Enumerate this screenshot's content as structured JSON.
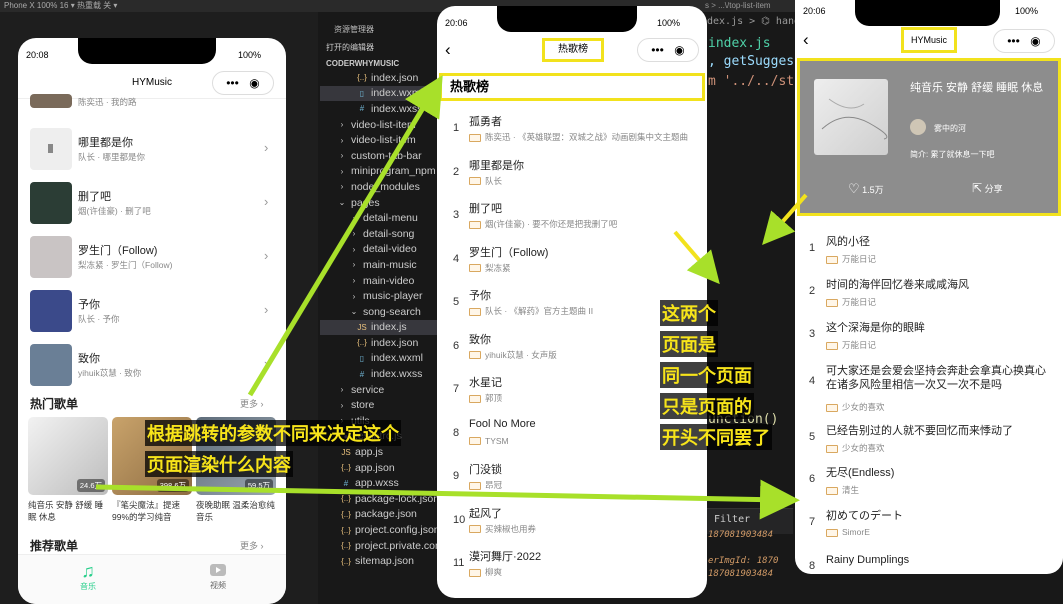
{
  "top_bar": {
    "text": "Phone X 100% 16 ▾    热重载 关 ▾",
    "breadcrumb": "s > ...\\/top-list-item"
  },
  "explorer": {
    "header": "资源管理器",
    "sections": [
      "打开的编辑器",
      "CODERWHYMUSIC"
    ],
    "items": [
      {
        "label": "index.json",
        "icon": "{..}",
        "color": "#e8c07d"
      },
      {
        "label": "index.wxml",
        "icon": "▯",
        "color": "#6fb3d2",
        "active": true
      },
      {
        "label": "index.wxss",
        "icon": "#",
        "color": "#6fb3d2"
      },
      {
        "label": "video-list-item",
        "icon": "›",
        "color": "#ccc"
      },
      {
        "label": "video-list-item",
        "icon": "›",
        "color": "#ccc"
      },
      {
        "label": "custom-tab-bar",
        "icon": "›",
        "color": "#ccc"
      },
      {
        "label": "miniprogram_npm",
        "icon": "›",
        "color": "#ccc"
      },
      {
        "label": "node_modules",
        "icon": "›",
        "color": "#ccc"
      },
      {
        "label": "pages",
        "icon": "⌄",
        "color": "#ccc"
      },
      {
        "label": "detail-menu",
        "icon": "›",
        "color": "#ccc"
      },
      {
        "label": "detail-song",
        "icon": "›",
        "color": "#ccc"
      },
      {
        "label": "detail-video",
        "icon": "›",
        "color": "#ccc"
      },
      {
        "label": "main-music",
        "icon": "›",
        "color": "#ccc"
      },
      {
        "label": "main-video",
        "icon": "›",
        "color": "#ccc"
      },
      {
        "label": "music-player",
        "icon": "›",
        "color": "#ccc"
      },
      {
        "label": "song-search",
        "icon": "⌄",
        "color": "#ccc"
      },
      {
        "label": "index.js",
        "icon": "JS",
        "color": "#e8c07d",
        "active": true
      },
      {
        "label": "index.json",
        "icon": "{..}",
        "color": "#e8c07d"
      },
      {
        "label": "index.wxml",
        "icon": "▯",
        "color": "#6fb3d2"
      },
      {
        "label": "index.wxss",
        "icon": "#",
        "color": "#6fb3d2"
      },
      {
        "label": "service",
        "icon": "›",
        "color": "#ccc"
      },
      {
        "label": "store",
        "icon": "›",
        "color": "#ccc"
      },
      {
        "label": "utils",
        "icon": "›",
        "color": "#ccc"
      },
      {
        "label": ".eslintrc.js",
        "icon": "●",
        "color": "#9b7fd6"
      },
      {
        "label": "app.js",
        "icon": "JS",
        "color": "#e8c07d"
      },
      {
        "label": "app.json",
        "icon": "{..}",
        "color": "#e8c07d"
      },
      {
        "label": "app.wxss",
        "icon": "#",
        "color": "#6fb3d2"
      },
      {
        "label": "package-lock.json",
        "icon": "{..}",
        "color": "#e8c07d"
      },
      {
        "label": "package.json",
        "icon": "{..}",
        "color": "#e8c07d"
      },
      {
        "label": "project.config.json",
        "icon": "{..}",
        "color": "#e8c07d"
      },
      {
        "label": "project.private.config.json",
        "icon": "{..}",
        "color": "#e8c07d"
      },
      {
        "label": "sitemap.json",
        "icon": "{..}",
        "color": "#e8c07d"
      }
    ]
  },
  "code": {
    "line1": "dex.js > ⌬ hand",
    "line2": "index.js",
    "line3": ", getSugges",
    "line4": "m '../../st",
    "line5": "unction()",
    "filter": "Filter",
    "console1": "187081903484",
    "console2": "erImgId: 1870",
    "console3": "187081903484"
  },
  "phone1": {
    "time": "20:08",
    "battery": "100%",
    "title": "HYMusic",
    "partial_meta": "陈奕迅 · 我的路",
    "songs": [
      {
        "name": "哪里都是你",
        "meta": "队长 · 哪里都是你"
      },
      {
        "name": "删了吧",
        "meta": "烟(许佳豪) · 删了吧"
      },
      {
        "name": "罗生门（Follow)",
        "meta": "梨冻紧 · 罗生门（Follow)"
      },
      {
        "name": "予你",
        "meta": "队长 · 予你"
      },
      {
        "name": "致你",
        "meta": "yihuik苡慧 · 致你"
      }
    ],
    "hot_title": "热门歌单",
    "more": "更多 ›",
    "hot_menus": [
      {
        "name": "纯音乐 安静 舒缓 睡眠 休息",
        "count": "24.6万"
      },
      {
        "name": "『笔尖魔法』提速99%的学习纯音",
        "count": "398.6万"
      },
      {
        "name": "夜晚助眠 温柔治愈纯音乐",
        "count": "59.5万"
      }
    ],
    "rec_title": "推荐歌单",
    "rec_more": "更多 ›",
    "tabs": [
      {
        "label": "音乐",
        "icon": "music-note"
      },
      {
        "label": "视频",
        "icon": "video"
      }
    ]
  },
  "phone2": {
    "time": "20:06",
    "battery": "100%",
    "nav_title": "热歌榜",
    "header": "热歌榜",
    "songs": [
      {
        "name": "孤勇者",
        "meta": "陈奕迅 · 《英雄联盟：双城之战》动画剧集中文主题曲"
      },
      {
        "name": "哪里都是你",
        "meta": "队长"
      },
      {
        "name": "删了吧",
        "meta": "烟(许佳豪) · 要不你还是把我删了吧"
      },
      {
        "name": "罗生门（Follow)",
        "meta": "梨冻紧"
      },
      {
        "name": "予你",
        "meta": "队长 · 《解药》官方主题曲 II"
      },
      {
        "name": "致你",
        "meta": "yihuik苡慧 · 女声版"
      },
      {
        "name": "水星记",
        "meta": "郭顶"
      },
      {
        "name": "Fool No More",
        "meta": "TYSM"
      },
      {
        "name": "门没锁",
        "meta": "昂冠"
      },
      {
        "name": "起风了",
        "meta": "买辣椒也用券"
      },
      {
        "name": "漠河舞厅·2022",
        "meta": "柳爽"
      }
    ]
  },
  "phone3": {
    "time": "20:06",
    "battery": "100%",
    "nav_title": "HYMusic",
    "menu_name": "纯音乐 安静 舒缓 睡眠 休息",
    "creator": "雾中的河",
    "desc": "简介: 累了就休息一下吧",
    "likes": "1.5万",
    "share": "分享",
    "songs": [
      {
        "name": "风的小径",
        "meta": "万能日记"
      },
      {
        "name": "时间的海伴回忆卷来咸咸海风",
        "meta": "万能日记"
      },
      {
        "name": "这个深海是你的眼眸",
        "meta": "万能日记"
      },
      {
        "name": "可大家还是会爱会坚持会奔赴会拿真心换真心在诸多风险里相信一次又一次不是吗",
        "meta": "少女的喜欢"
      },
      {
        "name": "已经告别过的人就不要回忆而来悸动了",
        "meta": "少女的喜欢"
      },
      {
        "name": "无尽(Endless)",
        "meta": "清生"
      },
      {
        "name": "初めてのデート",
        "meta": "SimorE"
      },
      {
        "name": "Rainy Dumplings",
        "meta": ""
      }
    ]
  },
  "annotations": {
    "left": [
      "根据跳转的参数不同来决定这个",
      "页面渲染什么内容"
    ],
    "right": [
      "这两个",
      "页面是",
      "同一个页面",
      "只是页面的",
      "开头不同罢了"
    ]
  },
  "colors": {
    "highlight": "#f2e21d",
    "arrow": "#a8e02a",
    "accent": "#26ce8a"
  }
}
